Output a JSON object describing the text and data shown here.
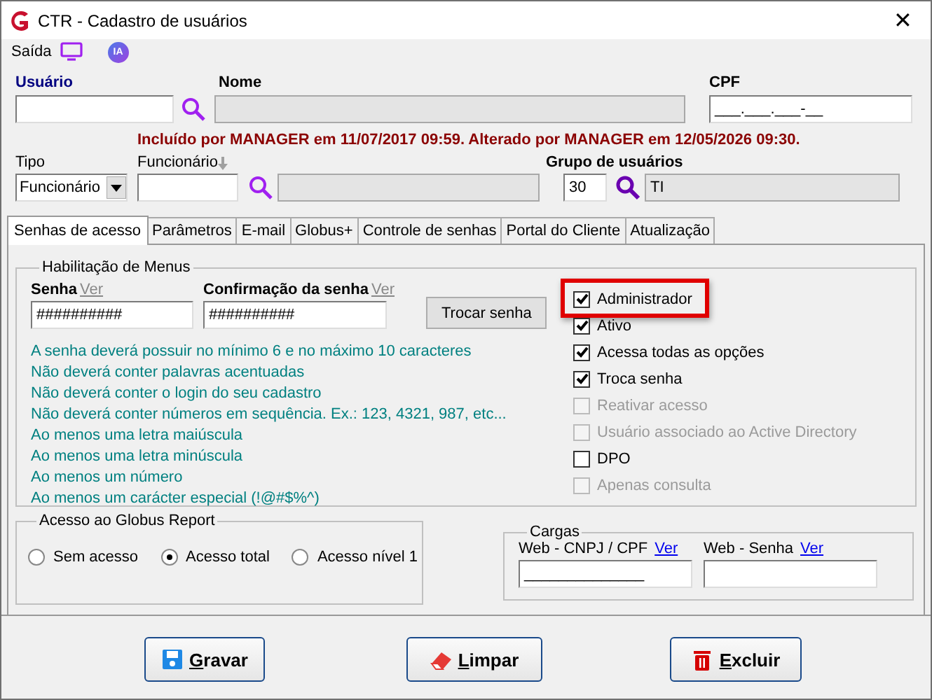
{
  "window": {
    "title": "CTR - Cadastro de usuários",
    "close": "✕"
  },
  "menu": {
    "label": "Saída",
    "badge": "IA"
  },
  "user_fields": [
    {
      "label": "Usuário",
      "kind": "code"
    },
    {
      "label": "Nome",
      "kind": "readonly"
    },
    {
      "label": "CPF",
      "value": "___.___.___-__",
      "kind": "plain"
    }
  ],
  "audit_message": "Incluído por MANAGER em 11/07/2017 09:59. Alterado por MANAGER em 12/05/2026 09:30.",
  "tipo": {
    "label": "Tipo",
    "value": "Funcionário"
  },
  "funcionario": {
    "label": "Funcionário"
  },
  "grupo": {
    "label": "Grupo de usuários",
    "code": "30",
    "name": "TI"
  },
  "tabs": [
    {
      "label": "Senhas de acesso",
      "selected": true
    },
    {
      "label": "Parâmetros",
      "selected": false
    },
    {
      "label": "E-mail",
      "selected": false
    },
    {
      "label": "Globus+",
      "selected": false
    },
    {
      "label": "Controle de senhas",
      "selected": false
    },
    {
      "label": "Portal do Cliente",
      "selected": false
    },
    {
      "label": "Atualização",
      "selected": false
    }
  ],
  "menus_group": {
    "title": "Habilitação de Menus",
    "password": {
      "label": "Senha",
      "link": "Ver",
      "value": "##########"
    },
    "confirmation": {
      "label": "Confirmação da senha",
      "link": "Ver",
      "value": "##########"
    },
    "change_button": "Trocar senha",
    "rules": [
      "A senha deverá possuir no mínimo 6 e no máximo 10 caracteres",
      "Não deverá conter palavras acentuadas",
      "Não deverá conter o login do seu cadastro",
      "Não deverá conter números em sequência. Ex.: 123, 4321, 987, etc...",
      "Ao menos uma letra maiúscula",
      "Ao menos uma letra minúscula",
      "Ao menos um número",
      "Ao menos um carácter especial (!@#$%^)"
    ],
    "options": [
      {
        "label": "Administrador",
        "checked": true,
        "disabled": false,
        "highlighted": true
      },
      {
        "label": "Ativo",
        "checked": true,
        "disabled": false,
        "highlighted": false
      },
      {
        "label": "Acessa todas as opções",
        "checked": true,
        "disabled": false,
        "highlighted": false
      },
      {
        "label": "Troca senha",
        "checked": true,
        "disabled": false,
        "highlighted": false
      },
      {
        "label": "Reativar acesso",
        "checked": false,
        "disabled": true,
        "highlighted": false
      },
      {
        "label": "Usuário associado ao Active Directory",
        "checked": false,
        "disabled": true,
        "highlighted": false
      },
      {
        "label": "DPO",
        "checked": false,
        "disabled": false,
        "highlighted": false
      },
      {
        "label": "Apenas consulta",
        "checked": false,
        "disabled": true,
        "highlighted": false
      }
    ]
  },
  "report_group": {
    "title": "Acesso ao Globus Report",
    "options": [
      {
        "label": "Sem acesso",
        "selected": false
      },
      {
        "label": "Acesso total",
        "selected": true
      },
      {
        "label": "Acesso nível 1",
        "selected": false
      }
    ]
  },
  "cargas_group": {
    "title": "Cargas",
    "fields": [
      {
        "label": "Web - CNPJ / CPF",
        "link": "Ver",
        "value": "______________"
      },
      {
        "label": "Web - Senha",
        "link": "Ver"
      }
    ]
  },
  "buttons": [
    {
      "label": "Gravar",
      "kind": "save"
    },
    {
      "label": "Limpar",
      "kind": "clear"
    },
    {
      "label": "Excluir",
      "kind": "delete"
    }
  ]
}
